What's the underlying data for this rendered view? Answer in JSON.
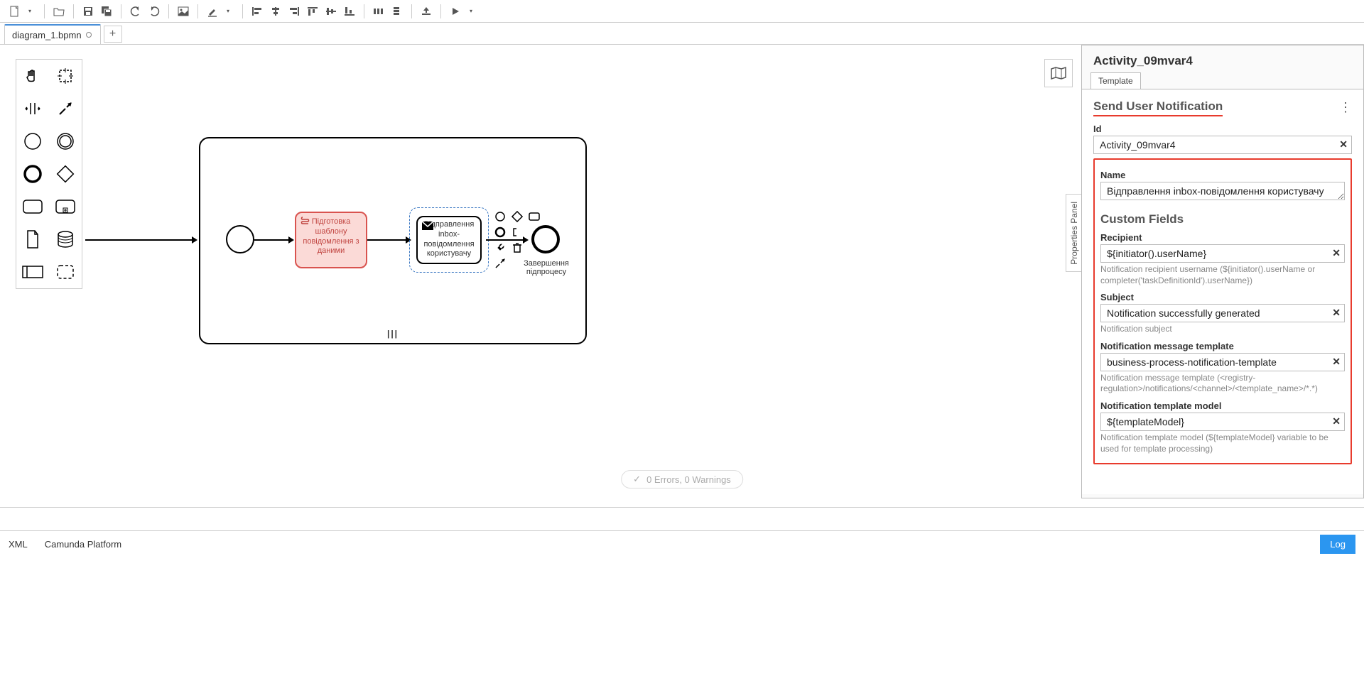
{
  "toolbar": {
    "new": "New",
    "open": "Open",
    "save": "Save",
    "saveAll": "Save All",
    "undo": "Undo",
    "redo": "Redo",
    "image": "Image",
    "color": "Color",
    "alignLeft": "Align Left",
    "alignCenter": "Align Center",
    "alignRight": "Align Right",
    "alignTop": "Align Top",
    "alignMiddle": "Align Middle",
    "alignBottom": "Align Bottom",
    "distH": "Distribute Horizontally",
    "distV": "Distribute Vertically",
    "upload": "Upload",
    "run": "Run"
  },
  "tabs": {
    "file": "diagram_1.bpmn",
    "add": "+"
  },
  "palette": {
    "hand": "Hand",
    "lasso": "Lasso",
    "space": "Space",
    "connect": "Connect",
    "start": "Start Event",
    "intermediate": "Intermediate Event",
    "end": "End Event",
    "gateway": "Gateway",
    "task": "Task",
    "sub": "Subprocess",
    "data": "Data Object",
    "store": "Data Store",
    "pool": "Pool",
    "group": "Group"
  },
  "diagram": {
    "scriptTask": "Підготовка шаблону повідомлення з даними",
    "sendTask": "Відправлення inbox-повідомлення користувачу",
    "endLabel": "Завершення підпроцесу"
  },
  "propsToggle": "Properties Panel",
  "props": {
    "elementId": "Activity_09mvar4",
    "tab": "Template",
    "templateName": "Send User Notification",
    "idLabel": "Id",
    "idValue": "Activity_09mvar4",
    "nameLabel": "Name",
    "nameValue": "Відправлення inbox-повідомлення користувачу",
    "customFields": "Custom Fields",
    "recipientLabel": "Recipient",
    "recipientValue": "${initiator().userName}",
    "recipientHint": "Notification recipient username (${initiator().userName or completer('taskDefinitionId').userName})",
    "subjectLabel": "Subject",
    "subjectValue": "Notification successfully generated",
    "subjectHint": "Notification subject",
    "msgTplLabel": "Notification message template",
    "msgTplValue": "business-process-notification-template",
    "msgTplHint": "Notification message template (<registry-regulation>/notifications/<channel>/<template_name>/*.*)",
    "tplModelLabel": "Notification template model",
    "tplModelValue": "${templateModel}",
    "tplModelHint": "Notification template model (${templateModel} variable to be used for template processing)"
  },
  "errors": "0 Errors, 0 Warnings",
  "bottom": {
    "xml": "XML",
    "platform": "Camunda Platform",
    "log": "Log"
  }
}
